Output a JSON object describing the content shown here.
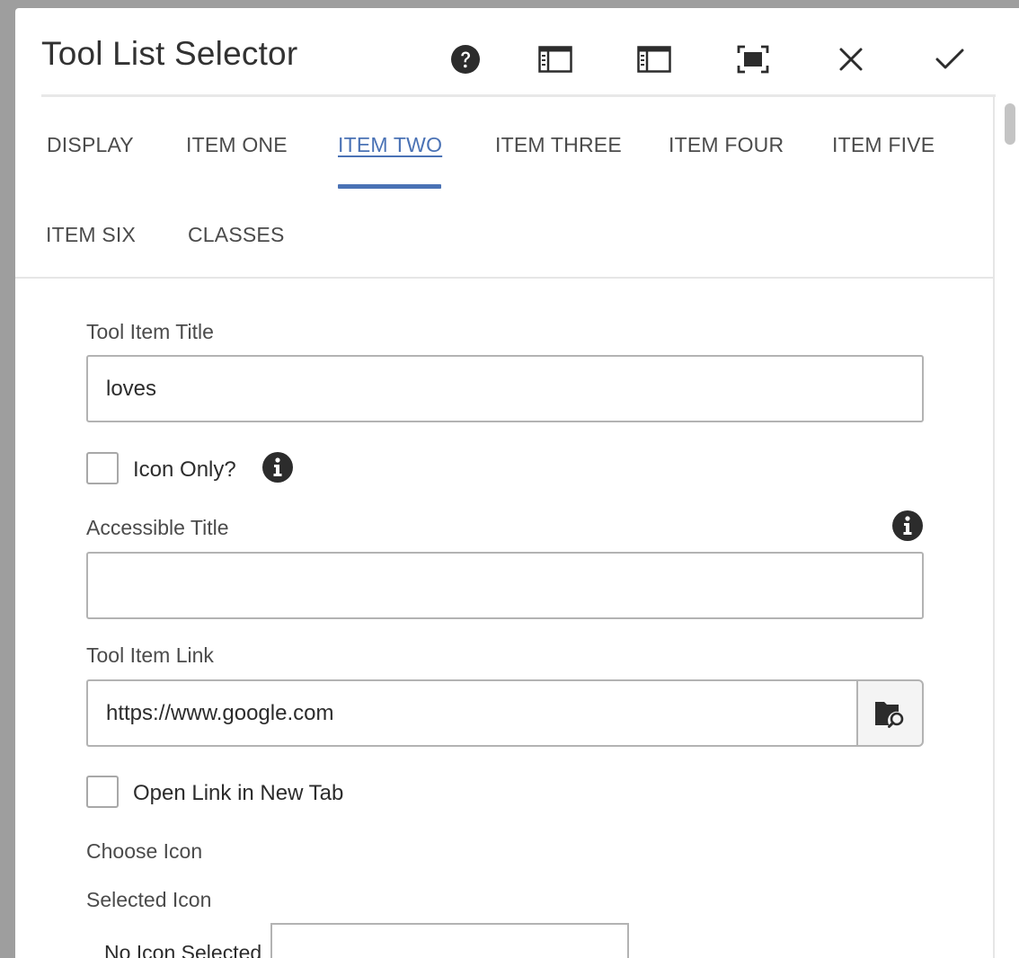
{
  "dialog": {
    "title": "Tool List Selector",
    "toolbar_icons": [
      "help-icon",
      "panel-left-icon",
      "panel-left-icon",
      "fullscreen-icon",
      "close-icon",
      "check-icon"
    ]
  },
  "tabs": [
    {
      "label": "DISPLAY",
      "active": false
    },
    {
      "label": "ITEM ONE",
      "active": false
    },
    {
      "label": "ITEM TWO",
      "active": true
    },
    {
      "label": "ITEM THREE",
      "active": false
    },
    {
      "label": "ITEM FOUR",
      "active": false
    },
    {
      "label": "ITEM FIVE",
      "active": false
    },
    {
      "label": "ITEM SIX",
      "active": false
    },
    {
      "label": "CLASSES",
      "active": false
    }
  ],
  "form": {
    "tool_item_title": {
      "label": "Tool Item Title",
      "value": "loves"
    },
    "icon_only": {
      "label": "Icon Only?",
      "checked": false
    },
    "accessible_title": {
      "label": "Accessible Title",
      "value": ""
    },
    "tool_item_link": {
      "label": "Tool Item Link",
      "value": "https://www.google.com"
    },
    "open_new_tab": {
      "label": "Open Link in New Tab",
      "checked": false
    },
    "choose_icon": {
      "label": "Choose Icon"
    },
    "selected_icon": {
      "label": "Selected Icon",
      "status": "No Icon Selected"
    }
  },
  "colors": {
    "accent": "#4a72b5",
    "border": "#b3b3b3",
    "icon": "#2c2c2c"
  }
}
